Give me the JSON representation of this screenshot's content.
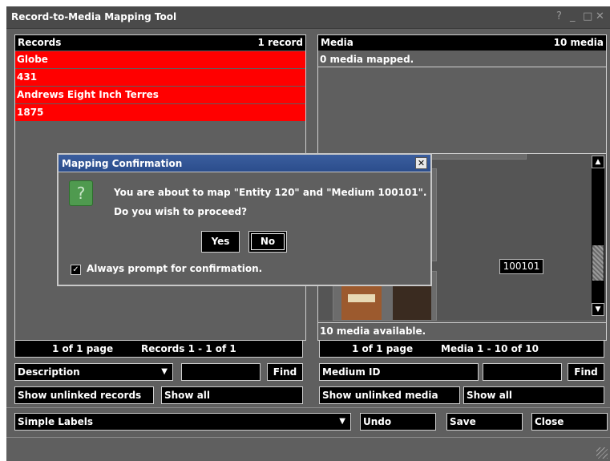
{
  "window": {
    "title": "Record-to-Media Mapping Tool",
    "help": "?",
    "minimize": "_",
    "maximize": "□",
    "close": "✕"
  },
  "records": {
    "header": "Records",
    "count": "1 record",
    "items": [
      "Globe",
      "431",
      "Andrews Eight Inch Terres",
      "1875"
    ],
    "page": "1 of 1 page",
    "range": "Records 1 - 1 of 1",
    "search_field": "Description",
    "search_value": "",
    "find": "Find",
    "show_unlinked": "Show unlinked records",
    "show_all": "Show all"
  },
  "media": {
    "header": "Media",
    "count": "10 media",
    "mapped_status": "0 media mapped.",
    "thumb_label": "100101",
    "available": "10 media available.",
    "page": "1 of 1 page",
    "range": "Media 1 - 10 of 10",
    "search_field": "Medium ID",
    "search_value": "",
    "find": "Find",
    "show_unlinked": "Show unlinked media",
    "show_all": "Show all"
  },
  "bottom": {
    "labels_select": "Simple Labels",
    "undo": "Undo",
    "save": "Save",
    "close": "Close"
  },
  "dialog": {
    "title": "Mapping Confirmation",
    "message1": "You are about to map \"Entity 120\" and \"Medium 100101\".",
    "message2": "Do you wish to proceed?",
    "yes": "Yes",
    "no": "No",
    "checkbox_label": "Always prompt for confirmation.",
    "checkbox_checked": true
  },
  "colors": {
    "record_selected": "#ff0000",
    "panel_bg": "#5f5f5f",
    "dialog_title": "#2b4d8c"
  }
}
